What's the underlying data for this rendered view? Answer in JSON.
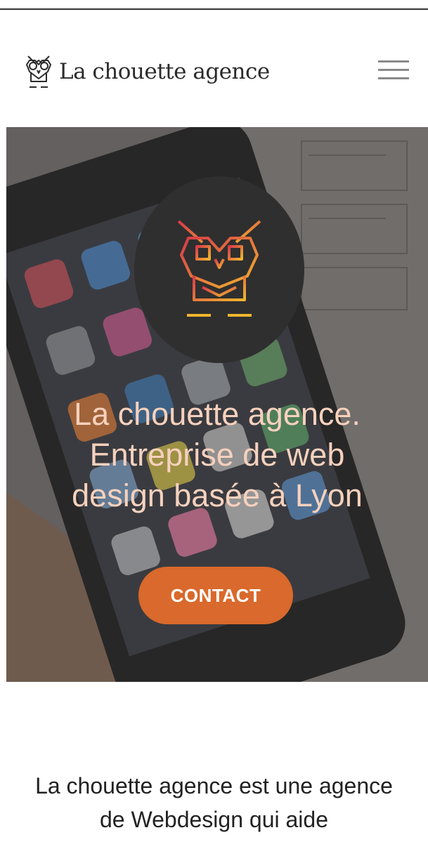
{
  "brand": {
    "name": "La chouette agence",
    "logo_icon": "owl-icon"
  },
  "nav": {
    "menu_icon": "hamburger-menu-icon"
  },
  "hero": {
    "title_lines": [
      "La chouette agence.",
      "Entreprise de web",
      "design basée à Lyon"
    ],
    "emblem_icon": "owl-icon",
    "cta_label": "CONTACT"
  },
  "intro": {
    "lines": [
      "La chouette agence est une agence",
      "de Webdesign qui aide"
    ]
  },
  "colors": {
    "accent": "#d9692c",
    "hero_text": "#f6d1bd",
    "emblem_bg": "#2f2f2f",
    "owl_gradient": [
      "#d93a4a",
      "#f0b52e"
    ]
  }
}
